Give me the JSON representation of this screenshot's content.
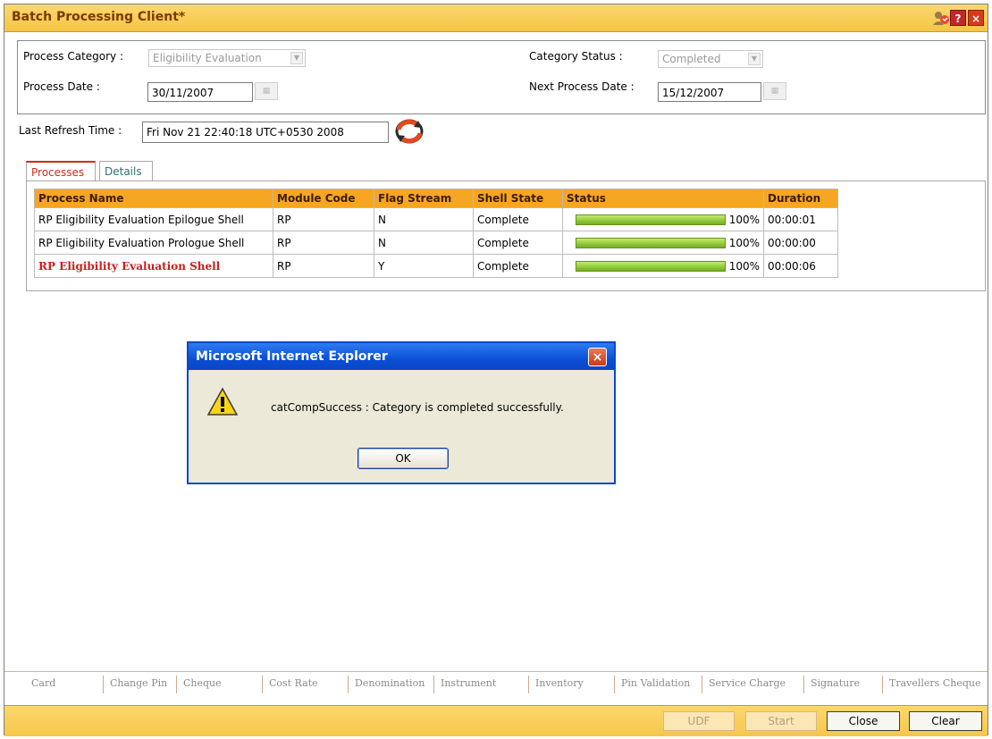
{
  "window": {
    "title": "Batch Processing Client*"
  },
  "filters": {
    "process_category_label": "Process Category :",
    "process_category_value": "Eligibility Evaluation",
    "category_status_label": "Category Status :",
    "category_status_value": "Completed",
    "process_date_label": "Process Date :",
    "process_date_value": "30/11/2007",
    "next_process_date_label": "Next Process Date :",
    "next_process_date_value": "15/12/2007",
    "last_refresh_label": "Last Refresh Time :",
    "last_refresh_value": "Fri Nov 21 22:40:18 UTC+0530 2008"
  },
  "tabs": [
    {
      "label": "Processes",
      "active": true
    },
    {
      "label": "Details",
      "active": false
    }
  ],
  "table": {
    "headers": [
      "Process Name",
      "Module Code",
      "Flag Stream",
      "Shell State",
      "Status",
      "Duration"
    ],
    "rows": [
      {
        "process_name": "RP Eligibility Evaluation Epilogue Shell",
        "module_code": "RP",
        "flag_stream": "N",
        "shell_state": "Complete",
        "status_percent": "100%",
        "progress": 1.0,
        "duration": "00:00:01",
        "highlight": false
      },
      {
        "process_name": "RP Eligibility Evaluation Prologue Shell",
        "module_code": "RP",
        "flag_stream": "N",
        "shell_state": "Complete",
        "status_percent": "100%",
        "progress": 1.0,
        "duration": "00:00:00",
        "highlight": false
      },
      {
        "process_name": "RP Eligibility Evaluation Shell",
        "module_code": "RP",
        "flag_stream": "Y",
        "shell_state": "Complete",
        "status_percent": "100%",
        "progress": 1.0,
        "duration": "00:00:06",
        "highlight": true
      }
    ]
  },
  "dialog": {
    "title": "Microsoft Internet Explorer",
    "message": "catCompSuccess : Category is completed successfully.",
    "ok_label": "OK",
    "icon": "warning-icon"
  },
  "bottom_tabs": [
    "Card",
    "Change Pin",
    "Cheque",
    "Cost Rate",
    "Denomination",
    "Instrument",
    "Inventory",
    "Pin Validation",
    "Service Charge",
    "Signature",
    "Travellers Cheque"
  ],
  "buttons": {
    "udf": "UDF",
    "start": "Start",
    "close": "Close",
    "clear": "Clear"
  },
  "colors": {
    "title_bar": "#f5c445",
    "table_header": "#f6a623",
    "highlight_text": "#c81e1e",
    "dialog_title": "#0b4fd6"
  }
}
